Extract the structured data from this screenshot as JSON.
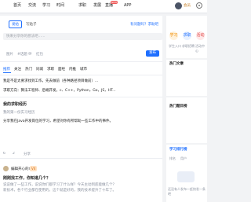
{
  "topbar": {
    "nav": [
      "首页",
      "交流",
      "学习",
      "时间",
      "求职",
      "发展",
      "直播",
      "APP"
    ],
    "badge_new": "NEW",
    "member_link": "会员"
  },
  "composer": {
    "tab_posts": "发帖",
    "draft_button": "写贴子",
    "side_link": "有问题吗？求助吧",
    "search_placeholder": "快来分享你的想法吧……",
    "toolbar": [
      "图片",
      "#话题",
      "@",
      "红包"
    ],
    "publish_button": "发布"
  },
  "feed_tabs": [
    "推荐",
    "关注",
    "热门",
    "同城",
    "求职",
    "面经",
    "内推",
    "城市"
  ],
  "posts": [
    {
      "lines": [
        "我是不是太要求找到工作，先去做前（各种路径项目做前）...",
        "求职方向：算法工程师、后端开发，c、C++，Python，Go，JS，HT..."
      ]
    },
    {
      "title": "我的求职经历",
      "lines": [
        "我的第一份实习经历",
        "分享我在Java开发岗位的学习，希望对你有所帮助一些工作中的事件。"
      ],
      "actions": {
        "like": "6",
        "comment": "2",
        "share": "分享"
      }
    },
    {
      "author": "编辑开心的水",
      "badge": "V4",
      "title": "刚刚找工作，你知道几个？",
      "lines": [
        "说说做了一些工作，说说你们都学习了什么样？今天主动到底能做几个？",
        "新技术，各个行业都在使用的，这个就是好的，我的技术提升了十年了。"
      ]
    }
  ],
  "sidebar": {
    "quick": [
      "学习",
      "求职",
      "活动"
    ],
    "quick_labels": [
      "学生入口",
      "求职招聘",
      "活动中心"
    ],
    "hot_title": "热门文章",
    "recommend_title": "热门题目榜",
    "goal_title": "学习排行榜",
    "goal_sub1": "排名",
    "goal_sub2": "用户",
    "goal_footer": "还没有人发布～赶快发一条吧"
  },
  "colors": {
    "accent": "#1e6fff",
    "badge_red": "#f05a5a"
  }
}
